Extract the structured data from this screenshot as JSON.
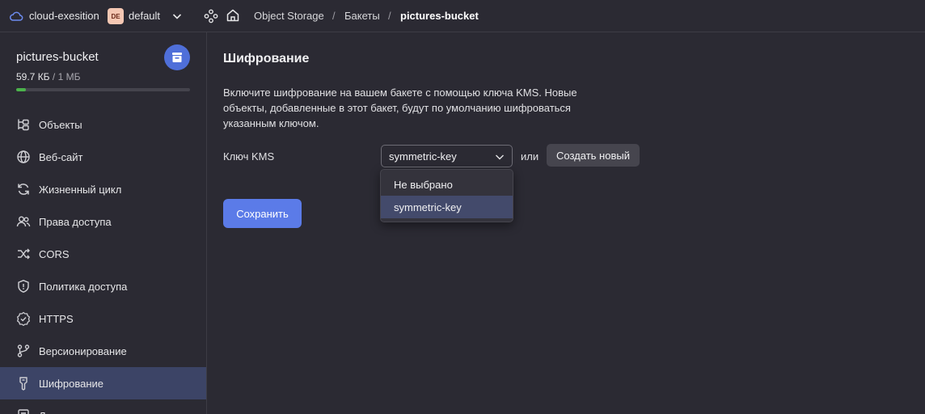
{
  "header": {
    "cloud_name": "cloud-exesition",
    "folder_badge": "DE",
    "folder_name": "default",
    "breadcrumbs": [
      "Object Storage",
      "Бакеты",
      "pictures-bucket"
    ],
    "separator": "/"
  },
  "sidebar": {
    "bucket_name": "pictures-bucket",
    "usage_used": "59.7 КБ",
    "usage_separator": " / ",
    "usage_total": "1 МБ",
    "usage_fraction": 0.058,
    "items": [
      {
        "label": "Объекты",
        "icon": "objects-icon"
      },
      {
        "label": "Веб-сайт",
        "icon": "globe-icon"
      },
      {
        "label": "Жизненный цикл",
        "icon": "lifecycle-icon"
      },
      {
        "label": "Права доступа",
        "icon": "users-icon"
      },
      {
        "label": "CORS",
        "icon": "cors-icon"
      },
      {
        "label": "Политика доступа",
        "icon": "shield-icon"
      },
      {
        "label": "HTTPS",
        "icon": "https-icon"
      },
      {
        "label": "Версионирование",
        "icon": "versioning-icon"
      },
      {
        "label": "Шифрование",
        "icon": "key-icon",
        "active": true
      },
      {
        "label": "Л",
        "icon": "log-icon"
      }
    ]
  },
  "main": {
    "title": "Шифрование",
    "description": "Включите шифрование на вашем бакете с помощью ключа KMS. Новые объекты, добавленные в этот бакет, будут по умолчанию шифроваться указанным ключом.",
    "kms_label": "Ключ KMS",
    "kms_selected": "symmetric-key",
    "or_text": "или",
    "create_button": "Создать новый",
    "dropdown_options": [
      "Не выбрано",
      "symmetric-key"
    ],
    "save_button": "Сохранить"
  },
  "colors": {
    "background": "#2b2a33",
    "accent": "#5b7be8",
    "active_nav": "#3c4466",
    "usage_green": "#4bb34b"
  }
}
